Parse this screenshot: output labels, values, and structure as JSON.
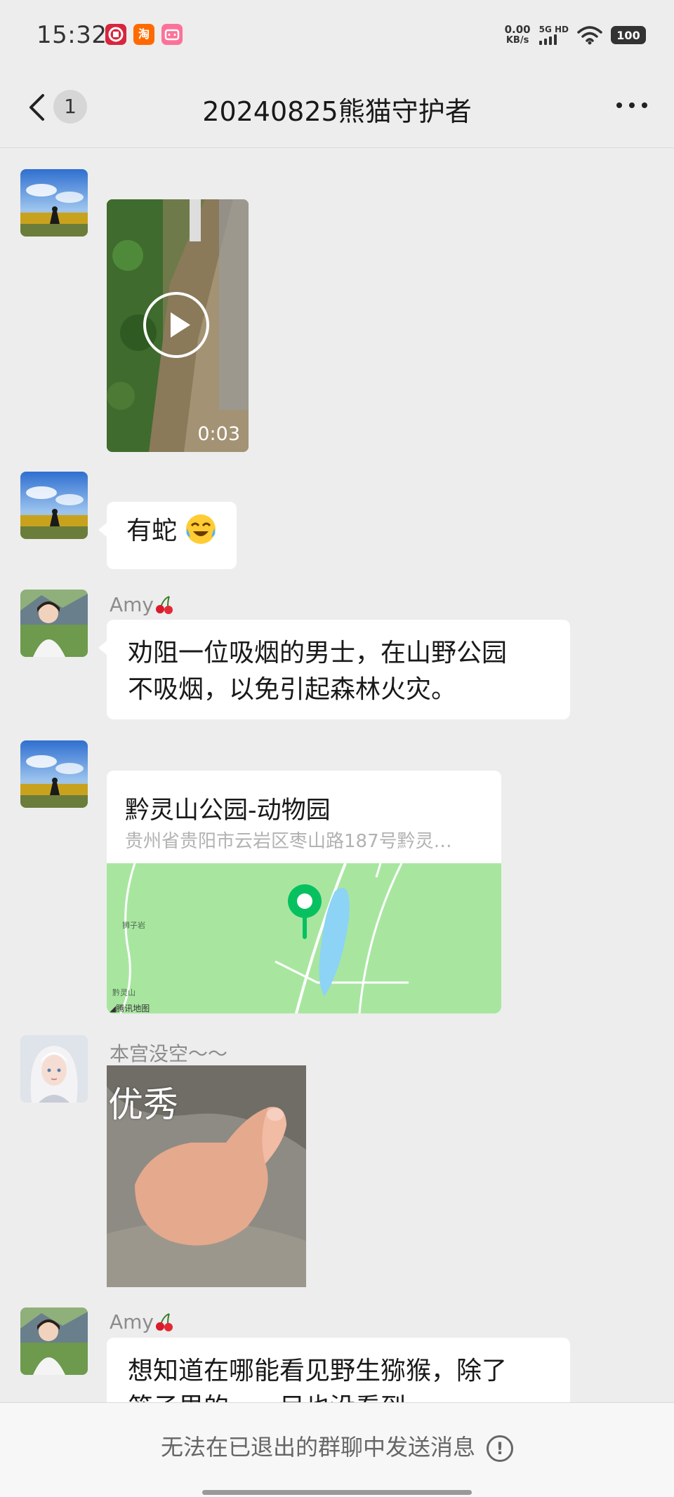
{
  "status_bar": {
    "time": "15:32",
    "net_speed_value": "0.00",
    "net_speed_unit": "KB/s",
    "network_label": "5G HD",
    "battery": "100",
    "apps": [
      {
        "icon": "bank-app-icon",
        "color": "#d7263d"
      },
      {
        "icon": "taobao-app-icon",
        "color": "#ff6a00",
        "glyph": "淘"
      },
      {
        "icon": "bilibili-app-icon",
        "color": "#fb7299"
      }
    ]
  },
  "nav": {
    "unread_count": "1",
    "title": "20240825熊猫守护者"
  },
  "messages": [
    {
      "type": "video",
      "duration": "0:03"
    },
    {
      "type": "text",
      "text": "有蛇"
    },
    {
      "type": "text",
      "sender": "Amy",
      "lines": [
        "劝阻一位吸烟的男士，在山野公园",
        "不吸烟，以免引起森林火灾。"
      ]
    },
    {
      "type": "location",
      "title": "黔灵山公园-动物园",
      "address": "贵州省贵阳市云岩区枣山路187号黔灵…",
      "map_provider": "腾讯地图",
      "map_labels": [
        "狮子岩",
        "黔灵山"
      ]
    },
    {
      "type": "image",
      "sender": "本宫没空～～",
      "caption": "优秀"
    },
    {
      "type": "text",
      "sender": "Amy",
      "lines": [
        "想知道在哪能看见野生猕猴，除了",
        "笼子里的……目也没看到……"
      ]
    }
  ],
  "bottom": {
    "notice": "无法在已退出的群聊中发送消息"
  },
  "colors": {
    "background": "#ededed",
    "bubble": "#ffffff",
    "map_green": "#a8e6a0",
    "pin": "#07c160"
  }
}
